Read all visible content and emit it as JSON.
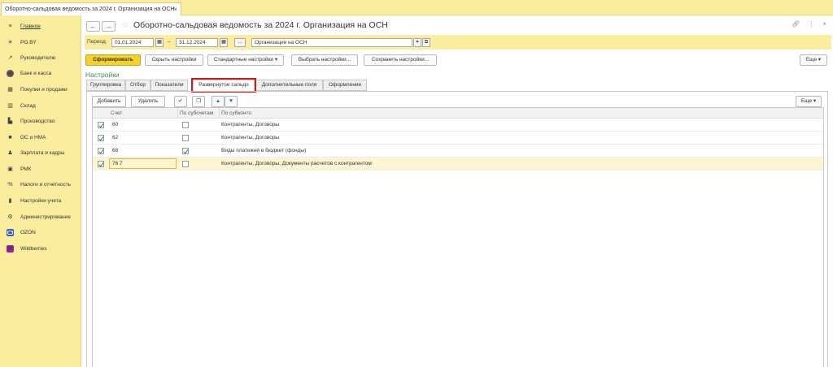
{
  "app": {
    "doc_tab_label": "Оборотно-сальдовая ведомость за 2024 г. Организация на ОСН",
    "doc_tab_close": "×"
  },
  "sidebar": {
    "items": [
      {
        "label": "Главное",
        "icon": "menu-icon",
        "glyph": "≡",
        "link": true
      },
      {
        "label": "PO.BY",
        "icon": "sun-icon",
        "glyph": "✳",
        "link": false
      },
      {
        "label": "Руководителю",
        "icon": "chart-trend-icon",
        "glyph": "↗",
        "link": false
      },
      {
        "label": "Банк и касса",
        "icon": "coins-icon",
        "glyph": "●",
        "link": false
      },
      {
        "label": "Покупки и продажи",
        "icon": "cart-icon",
        "glyph": "▦",
        "link": false
      },
      {
        "label": "Склад",
        "icon": "warehouse-icon",
        "glyph": "▥",
        "link": false
      },
      {
        "label": "Производство",
        "icon": "factory-icon",
        "glyph": "▙",
        "link": false
      },
      {
        "label": "ОС и НМА",
        "icon": "truck-icon",
        "glyph": "■",
        "link": false
      },
      {
        "label": "Зарплата и кадры",
        "icon": "person-icon",
        "glyph": "♟",
        "link": false
      },
      {
        "label": "РМК",
        "icon": "cash-register-icon",
        "glyph": "▣",
        "link": false
      },
      {
        "label": "Налоги и отчетность",
        "icon": "percent-icon",
        "glyph": "%",
        "link": false
      },
      {
        "label": "Настройки учета",
        "icon": "book-icon",
        "glyph": "▮",
        "link": false
      },
      {
        "label": "Администрирование",
        "icon": "gear-icon",
        "glyph": "⚙",
        "link": false
      },
      {
        "label": "OZON",
        "icon": "ozon-logo-icon",
        "glyph": "",
        "link": false
      },
      {
        "label": "Wildberries",
        "icon": "wildberries-logo-icon",
        "glyph": "W",
        "link": false
      }
    ]
  },
  "header": {
    "title": "Оборотно-сальдовая ведомость за 2024 г. Организация на ОСН",
    "back": "←",
    "forward": "→",
    "star": "☆",
    "link_icon": "🔗",
    "kebab": "⋮",
    "close": "×"
  },
  "period": {
    "label": "Период:",
    "from": "01.01.2024",
    "dash": "–",
    "to": "31.12.2024",
    "dots": "...",
    "organization": "Организация на ОСН"
  },
  "toolbar": {
    "generate": "Сформировать",
    "hide_settings": "Скрыть настройки",
    "standard_settings": "Стандартные настройки",
    "choose_settings": "Выбрать настройки...",
    "save_settings": "Сохранить настройки...",
    "more": "Еще"
  },
  "settings": {
    "title": "Настройки",
    "tabs": [
      "Группировка",
      "Отбор",
      "Показатели",
      "Развернутое сальдо",
      "Дополнительные поля",
      "Оформление"
    ],
    "active_tab": "Развернутое сальдо"
  },
  "panel_toolbar": {
    "add": "Добавить",
    "delete": "Удалить",
    "more": "Еще"
  },
  "grid": {
    "columns": [
      "Счет",
      "По субсчетам",
      "По субконто"
    ],
    "rows": [
      {
        "checked": true,
        "account": "60",
        "by_subaccounts": false,
        "by_subconto": "Контрагенты, Договоры",
        "selected": false
      },
      {
        "checked": true,
        "account": "62",
        "by_subaccounts": false,
        "by_subconto": "Контрагенты, Договоры",
        "selected": false
      },
      {
        "checked": true,
        "account": "68",
        "by_subaccounts": true,
        "by_subconto": "Виды платежей в бюджет (фонды)",
        "selected": false
      },
      {
        "checked": true,
        "account": "76.7",
        "by_subaccounts": false,
        "by_subconto": "Контрагенты, Договоры, Документы расчетов с контрагентом",
        "selected": true
      }
    ]
  },
  "colors": {
    "sidebar_bg": "#fbed9e",
    "primary_button": "#f5d12c",
    "section_title": "#4a8a56",
    "highlight": "#d11a1a",
    "selected_row": "#fdf4d2"
  }
}
